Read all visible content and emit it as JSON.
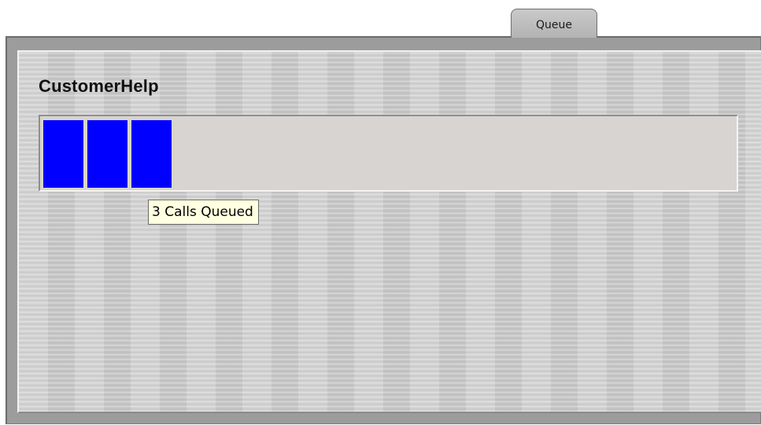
{
  "tabs": [
    {
      "label": "Queue",
      "selected": true
    }
  ],
  "queue": {
    "name": "CustomerHelp",
    "calls_queued": 3,
    "block_color": "#0000ff",
    "meter_background": "#d8d4d1"
  },
  "tooltip": {
    "text": "3 Calls Queued"
  },
  "colors": {
    "panel_metal": "#cfcfcf",
    "frame": "#9c9c9c",
    "tooltip_bg": "#ffffe1"
  }
}
